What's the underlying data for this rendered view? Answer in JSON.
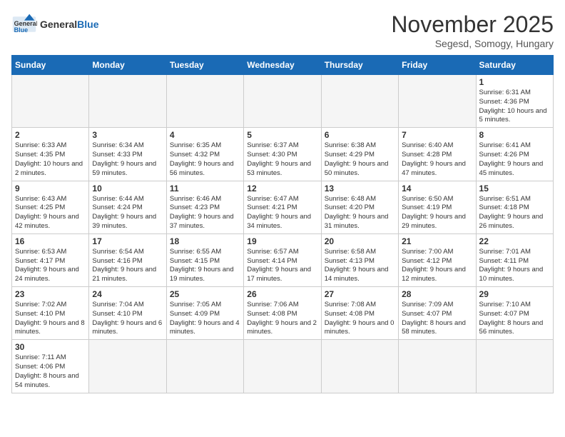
{
  "header": {
    "logo_general": "General",
    "logo_blue": "Blue",
    "month_title": "November 2025",
    "subtitle": "Segesd, Somogy, Hungary"
  },
  "weekdays": [
    "Sunday",
    "Monday",
    "Tuesday",
    "Wednesday",
    "Thursday",
    "Friday",
    "Saturday"
  ],
  "weeks": [
    [
      {
        "day": "",
        "info": ""
      },
      {
        "day": "",
        "info": ""
      },
      {
        "day": "",
        "info": ""
      },
      {
        "day": "",
        "info": ""
      },
      {
        "day": "",
        "info": ""
      },
      {
        "day": "",
        "info": ""
      },
      {
        "day": "1",
        "info": "Sunrise: 6:31 AM\nSunset: 4:36 PM\nDaylight: 10 hours and 5 minutes."
      }
    ],
    [
      {
        "day": "2",
        "info": "Sunrise: 6:33 AM\nSunset: 4:35 PM\nDaylight: 10 hours and 2 minutes."
      },
      {
        "day": "3",
        "info": "Sunrise: 6:34 AM\nSunset: 4:33 PM\nDaylight: 9 hours and 59 minutes."
      },
      {
        "day": "4",
        "info": "Sunrise: 6:35 AM\nSunset: 4:32 PM\nDaylight: 9 hours and 56 minutes."
      },
      {
        "day": "5",
        "info": "Sunrise: 6:37 AM\nSunset: 4:30 PM\nDaylight: 9 hours and 53 minutes."
      },
      {
        "day": "6",
        "info": "Sunrise: 6:38 AM\nSunset: 4:29 PM\nDaylight: 9 hours and 50 minutes."
      },
      {
        "day": "7",
        "info": "Sunrise: 6:40 AM\nSunset: 4:28 PM\nDaylight: 9 hours and 47 minutes."
      },
      {
        "day": "8",
        "info": "Sunrise: 6:41 AM\nSunset: 4:26 PM\nDaylight: 9 hours and 45 minutes."
      }
    ],
    [
      {
        "day": "9",
        "info": "Sunrise: 6:43 AM\nSunset: 4:25 PM\nDaylight: 9 hours and 42 minutes."
      },
      {
        "day": "10",
        "info": "Sunrise: 6:44 AM\nSunset: 4:24 PM\nDaylight: 9 hours and 39 minutes."
      },
      {
        "day": "11",
        "info": "Sunrise: 6:46 AM\nSunset: 4:23 PM\nDaylight: 9 hours and 37 minutes."
      },
      {
        "day": "12",
        "info": "Sunrise: 6:47 AM\nSunset: 4:21 PM\nDaylight: 9 hours and 34 minutes."
      },
      {
        "day": "13",
        "info": "Sunrise: 6:48 AM\nSunset: 4:20 PM\nDaylight: 9 hours and 31 minutes."
      },
      {
        "day": "14",
        "info": "Sunrise: 6:50 AM\nSunset: 4:19 PM\nDaylight: 9 hours and 29 minutes."
      },
      {
        "day": "15",
        "info": "Sunrise: 6:51 AM\nSunset: 4:18 PM\nDaylight: 9 hours and 26 minutes."
      }
    ],
    [
      {
        "day": "16",
        "info": "Sunrise: 6:53 AM\nSunset: 4:17 PM\nDaylight: 9 hours and 24 minutes."
      },
      {
        "day": "17",
        "info": "Sunrise: 6:54 AM\nSunset: 4:16 PM\nDaylight: 9 hours and 21 minutes."
      },
      {
        "day": "18",
        "info": "Sunrise: 6:55 AM\nSunset: 4:15 PM\nDaylight: 9 hours and 19 minutes."
      },
      {
        "day": "19",
        "info": "Sunrise: 6:57 AM\nSunset: 4:14 PM\nDaylight: 9 hours and 17 minutes."
      },
      {
        "day": "20",
        "info": "Sunrise: 6:58 AM\nSunset: 4:13 PM\nDaylight: 9 hours and 14 minutes."
      },
      {
        "day": "21",
        "info": "Sunrise: 7:00 AM\nSunset: 4:12 PM\nDaylight: 9 hours and 12 minutes."
      },
      {
        "day": "22",
        "info": "Sunrise: 7:01 AM\nSunset: 4:11 PM\nDaylight: 9 hours and 10 minutes."
      }
    ],
    [
      {
        "day": "23",
        "info": "Sunrise: 7:02 AM\nSunset: 4:10 PM\nDaylight: 9 hours and 8 minutes."
      },
      {
        "day": "24",
        "info": "Sunrise: 7:04 AM\nSunset: 4:10 PM\nDaylight: 9 hours and 6 minutes."
      },
      {
        "day": "25",
        "info": "Sunrise: 7:05 AM\nSunset: 4:09 PM\nDaylight: 9 hours and 4 minutes."
      },
      {
        "day": "26",
        "info": "Sunrise: 7:06 AM\nSunset: 4:08 PM\nDaylight: 9 hours and 2 minutes."
      },
      {
        "day": "27",
        "info": "Sunrise: 7:08 AM\nSunset: 4:08 PM\nDaylight: 9 hours and 0 minutes."
      },
      {
        "day": "28",
        "info": "Sunrise: 7:09 AM\nSunset: 4:07 PM\nDaylight: 8 hours and 58 minutes."
      },
      {
        "day": "29",
        "info": "Sunrise: 7:10 AM\nSunset: 4:07 PM\nDaylight: 8 hours and 56 minutes."
      }
    ],
    [
      {
        "day": "30",
        "info": "Sunrise: 7:11 AM\nSunset: 4:06 PM\nDaylight: 8 hours and 54 minutes."
      },
      {
        "day": "",
        "info": ""
      },
      {
        "day": "",
        "info": ""
      },
      {
        "day": "",
        "info": ""
      },
      {
        "day": "",
        "info": ""
      },
      {
        "day": "",
        "info": ""
      },
      {
        "day": "",
        "info": ""
      }
    ]
  ]
}
